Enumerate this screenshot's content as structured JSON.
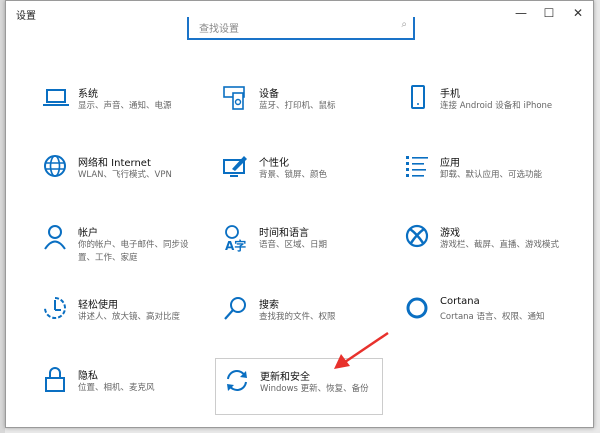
{
  "window": {
    "title": "设置",
    "minimize": "—",
    "maximize": "☐",
    "close": "✕"
  },
  "search": {
    "placeholder": "查找设置",
    "icon": "search-icon"
  },
  "tiles": [
    {
      "id": "system",
      "icon": "laptop",
      "title": "系统",
      "desc": "显示、声音、通知、电源"
    },
    {
      "id": "devices",
      "icon": "devices",
      "title": "设备",
      "desc": "蓝牙、打印机、鼠标"
    },
    {
      "id": "phone",
      "icon": "phone",
      "title": "手机",
      "desc": "连接 Android 设备和 iPhone"
    },
    {
      "id": "network",
      "icon": "globe",
      "title": "网络和 Internet",
      "desc": "WLAN、飞行模式、VPN"
    },
    {
      "id": "personalization",
      "icon": "brush",
      "title": "个性化",
      "desc": "背景、锁屏、颜色"
    },
    {
      "id": "apps",
      "icon": "list",
      "title": "应用",
      "desc": "卸载、默认应用、可选功能"
    },
    {
      "id": "accounts",
      "icon": "person",
      "title": "帐户",
      "desc": "你的帐户、电子邮件、同步设置、工作、家庭"
    },
    {
      "id": "time-language",
      "icon": "time-language",
      "title": "时间和语言",
      "desc": "语音、区域、日期"
    },
    {
      "id": "gaming",
      "icon": "xbox",
      "title": "游戏",
      "desc": "游戏栏、截屏、直播、游戏模式"
    },
    {
      "id": "ease-of-access",
      "icon": "ease",
      "title": "轻松使用",
      "desc": "讲述人、放大镜、高对比度"
    },
    {
      "id": "search",
      "icon": "magnifier",
      "title": "搜索",
      "desc": "查找我的文件、权限"
    },
    {
      "id": "cortana",
      "icon": "circle",
      "title": "Cortana",
      "desc": "Cortana 语言、权限、通知"
    },
    {
      "id": "privacy",
      "icon": "lock",
      "title": "隐私",
      "desc": "位置、相机、麦克风"
    },
    {
      "id": "update-security",
      "icon": "sync",
      "title": "更新和安全",
      "desc": "Windows 更新、恢复、备份",
      "highlighted": true
    }
  ],
  "colors": {
    "accent": "#0a6fc2",
    "arrow": "#e8312c"
  }
}
